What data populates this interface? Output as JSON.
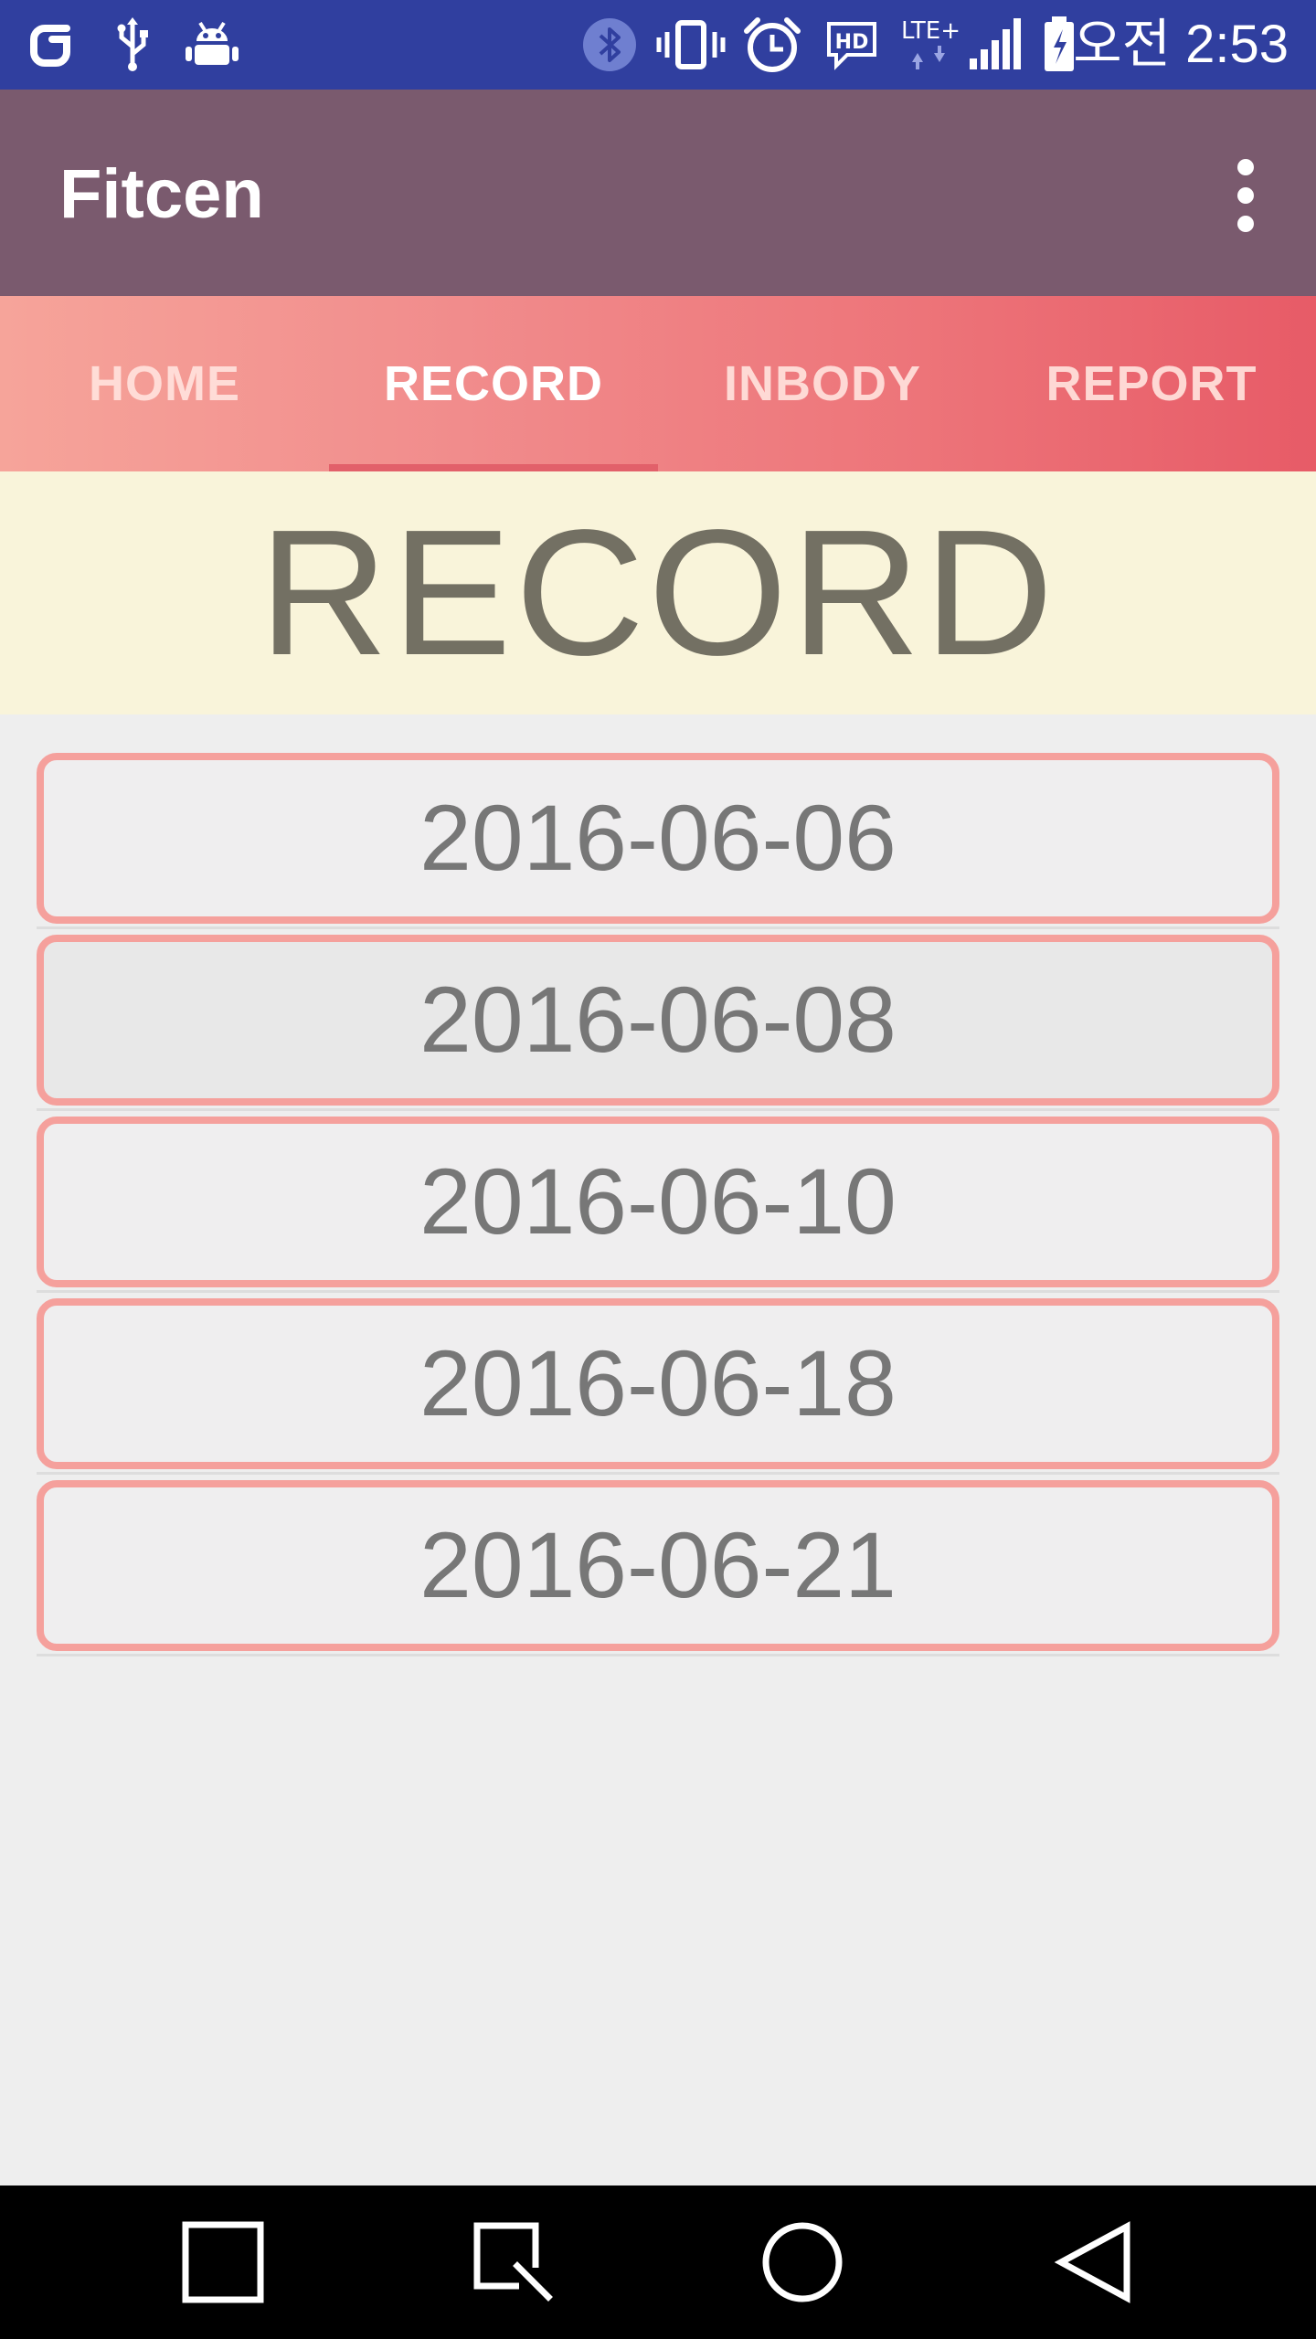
{
  "status_bar": {
    "time": "오전 2:53",
    "background": "#303f9f",
    "left_icons": [
      "app-notification-icon",
      "usb-icon",
      "android-debug-icon"
    ],
    "right_icons": [
      "bluetooth-icon",
      "vibrate-icon",
      "alarm-icon",
      "hd-voice-icon",
      "lte-plus-icon",
      "signal-icon",
      "battery-icon"
    ],
    "network_label": "LTE+",
    "hd_label": "HD"
  },
  "app_bar": {
    "title": "Fitcen",
    "background": "#7a5a6e"
  },
  "tabs": [
    {
      "label": "HOME",
      "active": false
    },
    {
      "label": "RECORD",
      "active": true
    },
    {
      "label": "INBODY",
      "active": false
    },
    {
      "label": "REPORT",
      "active": false
    }
  ],
  "banner": {
    "heading": "RECORD",
    "background": "#f9f4da"
  },
  "records": [
    {
      "date": "2016-06-06"
    },
    {
      "date": "2016-06-08"
    },
    {
      "date": "2016-06-10"
    },
    {
      "date": "2016-06-18"
    },
    {
      "date": "2016-06-21"
    }
  ],
  "colors": {
    "accent_border": "#f5a09c",
    "tab_indicator": "#e2606a",
    "tab_gradient_start": "#f6a49a",
    "tab_gradient_end": "#e75b67"
  },
  "nav_bar": {
    "buttons": [
      "recent-apps-icon",
      "screen-capture-icon",
      "home-icon",
      "back-icon"
    ]
  }
}
